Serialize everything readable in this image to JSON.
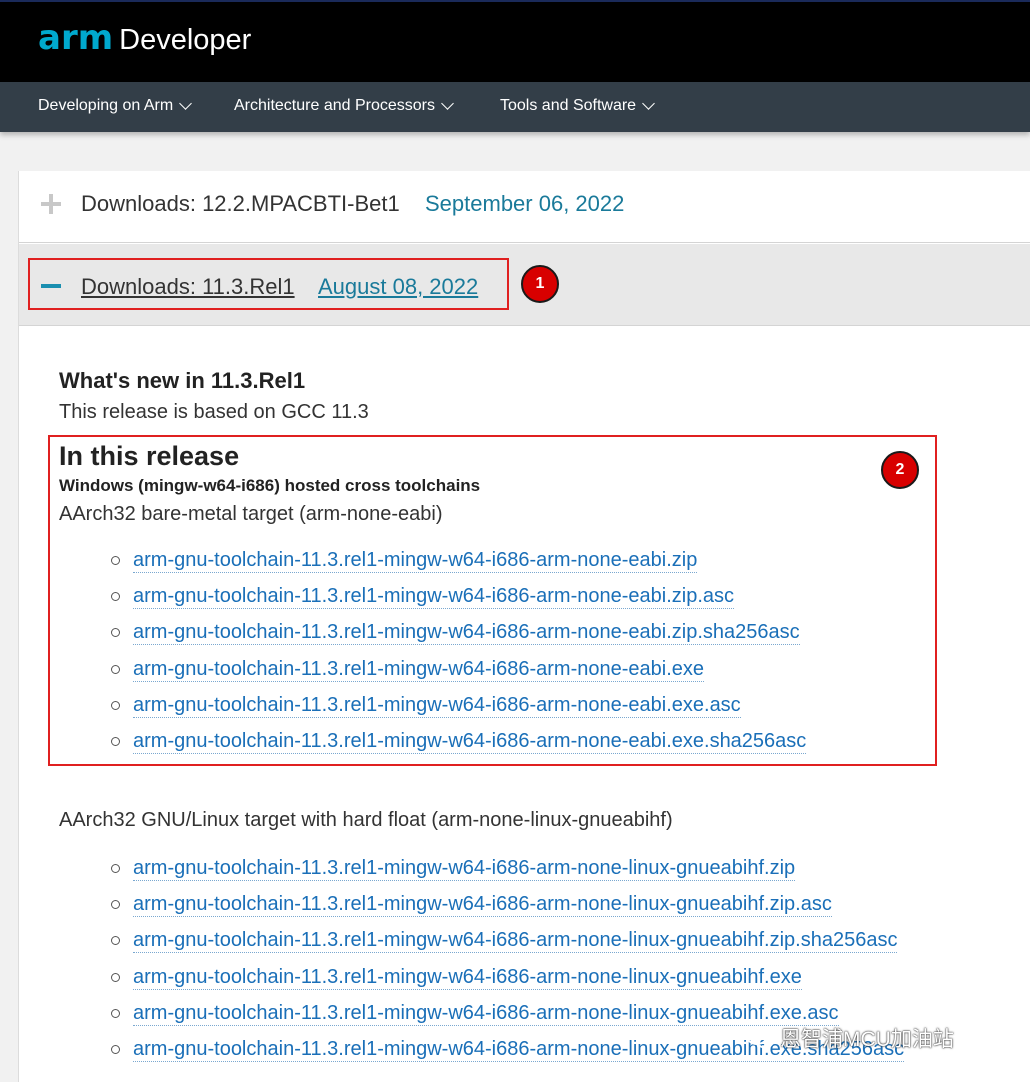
{
  "header": {
    "logo_arm": "arm",
    "logo_developer": "Developer"
  },
  "nav": {
    "items": [
      {
        "label": "Developing on Arm"
      },
      {
        "label": "Architecture and Processors"
      },
      {
        "label": "Tools and Software"
      }
    ]
  },
  "downloads": [
    {
      "title": "Downloads: 12.2.MPACBTI-Bet1",
      "date": "September 06, 2022",
      "expanded": false
    },
    {
      "title": "Downloads: 11.3.Rel1",
      "date": "August 08, 2022",
      "expanded": true
    }
  ],
  "annotations": {
    "badge_1": "1",
    "badge_2": "2"
  },
  "release": {
    "whats_new_heading": "What's new in 11.3.Rel1",
    "whats_new_text": "This release is based on GCC 11.3",
    "in_this_release_heading": "In this release",
    "host_heading": "Windows (mingw-w64-i686) hosted cross toolchains",
    "groups": [
      {
        "target": "AArch32 bare-metal target (arm-none-eabi)",
        "files": [
          "arm-gnu-toolchain-11.3.rel1-mingw-w64-i686-arm-none-eabi.zip",
          "arm-gnu-toolchain-11.3.rel1-mingw-w64-i686-arm-none-eabi.zip.asc",
          "arm-gnu-toolchain-11.3.rel1-mingw-w64-i686-arm-none-eabi.zip.sha256asc",
          "arm-gnu-toolchain-11.3.rel1-mingw-w64-i686-arm-none-eabi.exe",
          "arm-gnu-toolchain-11.3.rel1-mingw-w64-i686-arm-none-eabi.exe.asc",
          "arm-gnu-toolchain-11.3.rel1-mingw-w64-i686-arm-none-eabi.exe.sha256asc"
        ]
      },
      {
        "target": "AArch32 GNU/Linux target with hard float (arm-none-linux-gnueabihf)",
        "files": [
          "arm-gnu-toolchain-11.3.rel1-mingw-w64-i686-arm-none-linux-gnueabihf.zip",
          "arm-gnu-toolchain-11.3.rel1-mingw-w64-i686-arm-none-linux-gnueabihf.zip.asc",
          "arm-gnu-toolchain-11.3.rel1-mingw-w64-i686-arm-none-linux-gnueabihf.zip.sha256asc",
          "arm-gnu-toolchain-11.3.rel1-mingw-w64-i686-arm-none-linux-gnueabihf.exe",
          "arm-gnu-toolchain-11.3.rel1-mingw-w64-i686-arm-none-linux-gnueabihf.exe.asc",
          "arm-gnu-toolchain-11.3.rel1-mingw-w64-i686-arm-none-linux-gnueabihf.exe.sha256asc"
        ]
      }
    ]
  },
  "watermark": {
    "text": "恩智浦MCU加油站"
  }
}
